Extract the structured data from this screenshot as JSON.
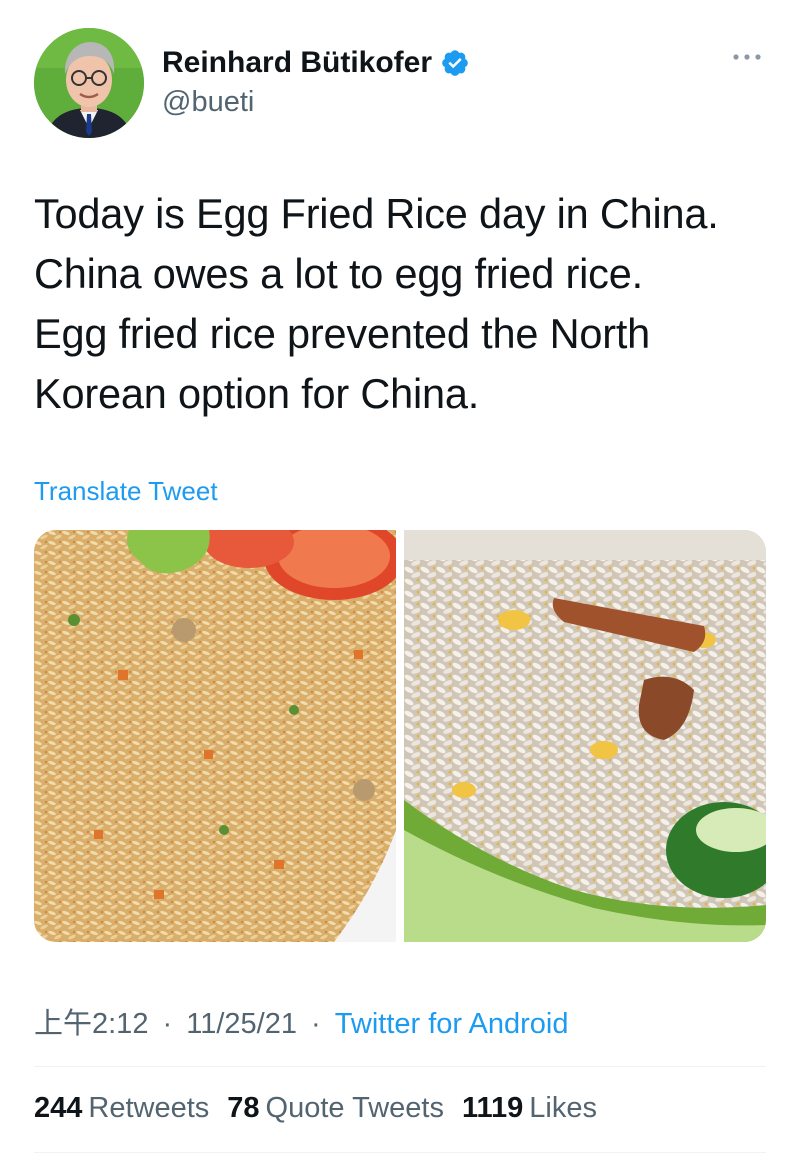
{
  "author": {
    "display_name": "Reinhard Bütikofer",
    "handle": "@bueti",
    "verified": true,
    "avatar_bg": "#5fae3b"
  },
  "tweet": {
    "lines": [
      "Today is Egg Fried Rice day in China.",
      "China owes a lot to egg fried rice.",
      "Egg fried rice prevented the North",
      "Korean option for China."
    ],
    "translate_label": "Translate Tweet",
    "time": "上午2:12",
    "date": "11/25/21",
    "separator": "·",
    "source": "Twitter for Android"
  },
  "media": [
    {
      "name": "fried rice with tomato and lettuce"
    },
    {
      "name": "egg fried rice with spring onion"
    }
  ],
  "stats": {
    "retweets_count": "244",
    "retweets_label": "Retweets",
    "quotes_count": "78",
    "quotes_label": "Quote Tweets",
    "likes_count": "1119",
    "likes_label": "Likes"
  },
  "colors": {
    "link": "#1d9bf0",
    "secondary_text": "#536471",
    "primary_text": "#0f1419",
    "verified_badge": "#1d9bf0"
  },
  "icons": {
    "verified": "verified-badge-icon",
    "more": "more-options-icon"
  }
}
